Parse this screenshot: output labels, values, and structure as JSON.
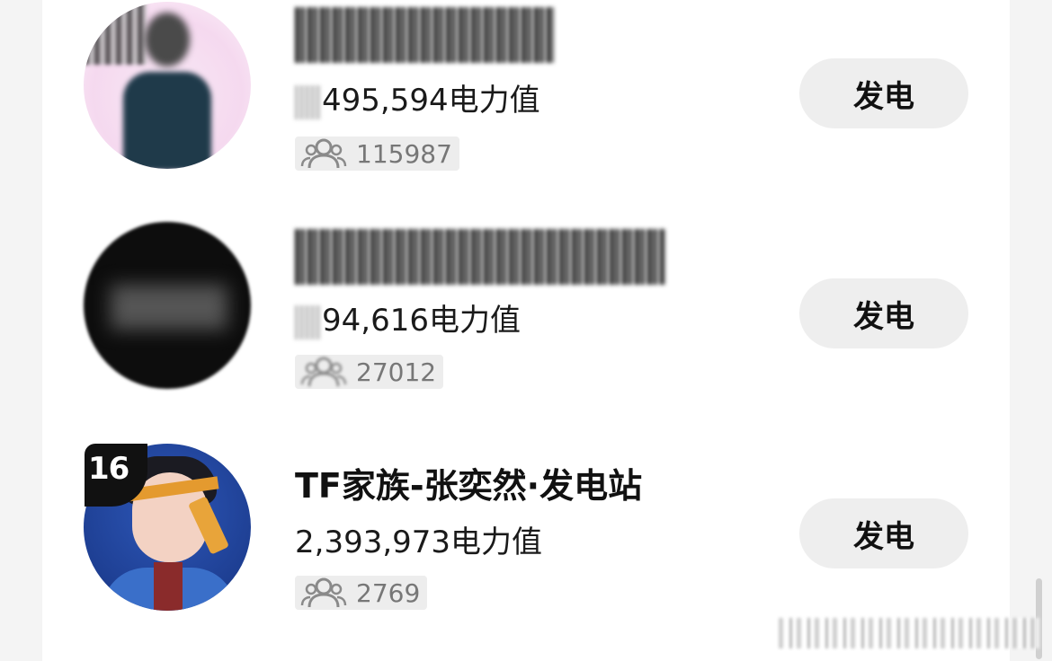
{
  "list": [
    {
      "rank": "",
      "name": "",
      "power_value": "495,594电力值",
      "fans_count": "115987",
      "button_label": "发电",
      "avatar_style": "blurred-pink"
    },
    {
      "rank": "",
      "name": "",
      "power_value": "94,616电力值",
      "fans_count": "27012",
      "button_label": "发电",
      "avatar_style": "blurred-dark"
    },
    {
      "rank": "16",
      "name": "TF家族-张奕然·发电站",
      "power_value": "2,393,973电力值",
      "fans_count": "2769",
      "button_label": "发电",
      "avatar_style": "photo"
    }
  ],
  "icons": {
    "fans": "users-icon"
  },
  "colors": {
    "button_bg": "#eeeeee",
    "fans_bg": "#ededed",
    "badge_bg": "#111111"
  }
}
